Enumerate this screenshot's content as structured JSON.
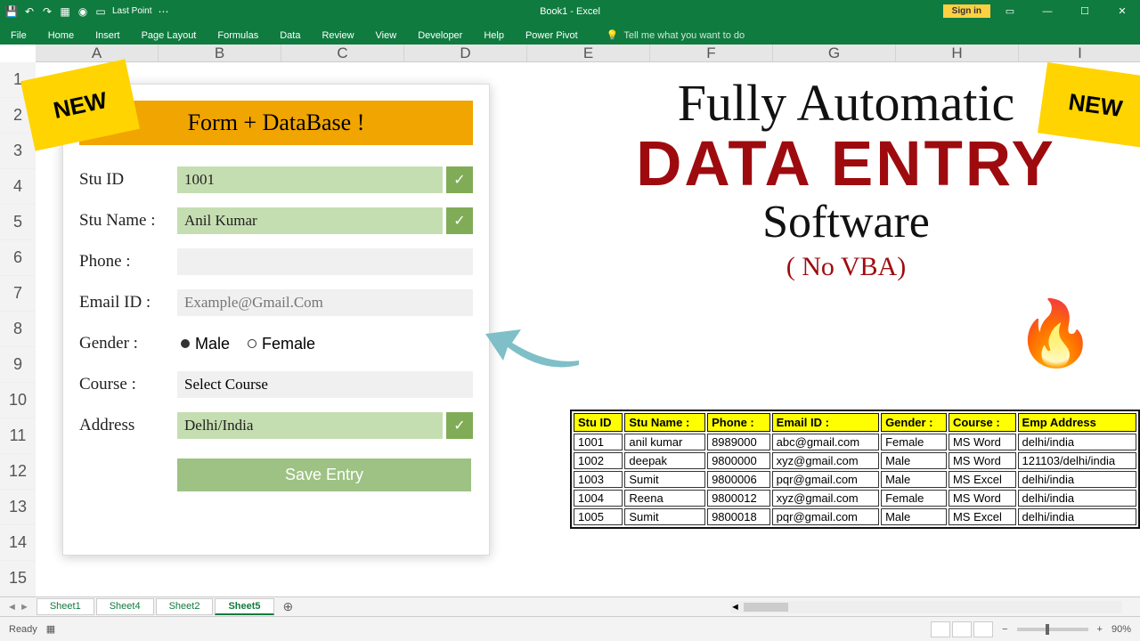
{
  "title": "Book1 - Excel",
  "signin": "Sign in",
  "qat_label": "Last Point",
  "ribbon_tabs": [
    "File",
    "Home",
    "Insert",
    "Page Layout",
    "Formulas",
    "Data",
    "Review",
    "View",
    "Developer",
    "Help",
    "Power Pivot"
  ],
  "tell_me": "Tell me what you want to do",
  "columns": [
    "A",
    "B",
    "C",
    "D",
    "E",
    "F",
    "G",
    "H",
    "I"
  ],
  "rows": [
    "1",
    "2",
    "3",
    "4",
    "5",
    "6",
    "7",
    "8",
    "9",
    "10",
    "11",
    "12",
    "13",
    "14",
    "15"
  ],
  "form": {
    "title": "Form + DataBase !",
    "fields": {
      "id_label": "Stu ID",
      "id_value": "1001",
      "name_label": "Stu Name :",
      "name_value": "Anil Kumar",
      "phone_label": "Phone :",
      "phone_value": "",
      "email_label": "Email ID :",
      "email_placeholder": "Example@Gmail.Com",
      "gender_label": "Gender :",
      "gender_male": "Male",
      "gender_female": "Female",
      "course_label": "Course :",
      "course_value": "Select Course",
      "address_label": "Address",
      "address_value": "Delhi/India"
    },
    "save": "Save Entry"
  },
  "promo": {
    "line1": "Fully Automatic",
    "line2": "DATA ENTRY",
    "line3": "Software",
    "line4": "( No VBA)"
  },
  "badge": "NEW",
  "table": {
    "headers": [
      "Stu ID",
      "Stu Name :",
      "Phone :",
      "Email ID :",
      "Gender :",
      "Course :",
      "Emp Address"
    ],
    "rows": [
      [
        "1001",
        "anil kumar",
        "8989000",
        "abc@gmail.com",
        "Female",
        "MS Word",
        "delhi/india"
      ],
      [
        "1002",
        "deepak",
        "9800000",
        "xyz@gmail.com",
        "Male",
        "MS Word",
        "121103/delhi/india"
      ],
      [
        "1003",
        "Sumit",
        "9800006",
        "pqr@gmail.com",
        "Male",
        "MS Excel",
        "delhi/india"
      ],
      [
        "1004",
        "Reena",
        "9800012",
        "xyz@gmail.com",
        "Female",
        "MS Word",
        "delhi/india"
      ],
      [
        "1005",
        "Sumit",
        "9800018",
        "pqr@gmail.com",
        "Male",
        "MS Excel",
        "delhi/india"
      ]
    ]
  },
  "sheets": [
    "Sheet1",
    "Sheet4",
    "Sheet2",
    "Sheet5"
  ],
  "active_sheet": 3,
  "status": "Ready",
  "zoom": "90%"
}
